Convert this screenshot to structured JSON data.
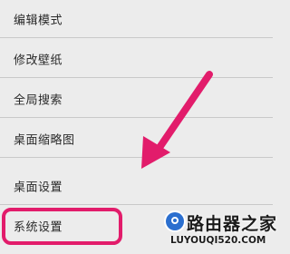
{
  "menu": {
    "items": [
      {
        "label": "编辑模式"
      },
      {
        "label": "修改壁纸"
      },
      {
        "label": "全局搜索"
      },
      {
        "label": "桌面缩略图"
      },
      {
        "label": "桌面设置"
      },
      {
        "label": "系统设置",
        "highlighted": true
      }
    ]
  },
  "annotation": {
    "arrow_color": "#e21c6b",
    "highlight_color": "#e21c6b"
  },
  "watermark": {
    "name": "路由器之家",
    "url": "LUYOUQI520.COM"
  }
}
